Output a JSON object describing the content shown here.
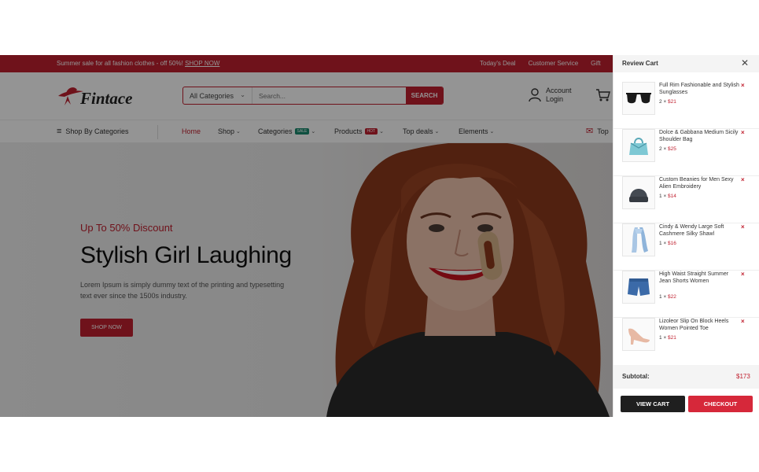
{
  "topbar": {
    "promo_text": "Summer sale for all fashion clothes - off 50%!",
    "promo_link": "SHOP NOW",
    "links": [
      "Today's Deal",
      "Customer Service",
      "Gift"
    ]
  },
  "header": {
    "logo_text": "Fintace",
    "search": {
      "category": "All Categories",
      "placeholder": "Search...",
      "button": "SEARCH"
    },
    "account_line1": "Account",
    "account_line2": "Login"
  },
  "nav": {
    "categories": "Shop By Categories",
    "items": [
      {
        "label": "Home"
      },
      {
        "label": "Shop"
      },
      {
        "label": "Categories",
        "badge": "SALE"
      },
      {
        "label": "Products",
        "badge": "HOT"
      },
      {
        "label": "Top deals"
      },
      {
        "label": "Elements"
      }
    ],
    "right_label": "Top"
  },
  "hero": {
    "subtitle": "Up To 50% Discount",
    "title": "Stylish Girl Laughing",
    "description": "Lorem Ipsum is simply dummy text of the printing and typesetting text ever since the 1500s industry.",
    "button": "SHOP NOW"
  },
  "cart": {
    "title": "Review Cart",
    "items": [
      {
        "name": "Full Rim Fashionable and Stylish Sunglasses",
        "qty": "2",
        "price": "$21",
        "icon": "sunglasses-icon"
      },
      {
        "name": "Dolce & Gabbana Medium Sicily Shoulder Bag",
        "qty": "2",
        "price": "$25",
        "icon": "handbag-icon"
      },
      {
        "name": "Custom Beanies for Men Sexy Alien Embroidery",
        "qty": "1",
        "price": "$14",
        "icon": "beanie-icon"
      },
      {
        "name": "Cindy & Wendy Large Soft Cashmere Silky Shawl",
        "qty": "1",
        "price": "$16",
        "icon": "shawl-icon"
      },
      {
        "name": "High Waist Straight Summer Jean Shorts Women",
        "qty": "1",
        "price": "$22",
        "icon": "shorts-icon"
      },
      {
        "name": "Lizoleor Slip On Block Heels Women Pointed Toe",
        "qty": "1",
        "price": "$21",
        "icon": "heels-icon"
      }
    ],
    "subtotal_label": "Subtotal:",
    "subtotal_value": "$173",
    "view_cart": "VIEW CART",
    "checkout": "CHECKOUT",
    "multiply": "×"
  },
  "colors": {
    "brand_red": "#c0202f",
    "checkout_red": "#d6283a",
    "dark_button": "#1f1f1f"
  }
}
